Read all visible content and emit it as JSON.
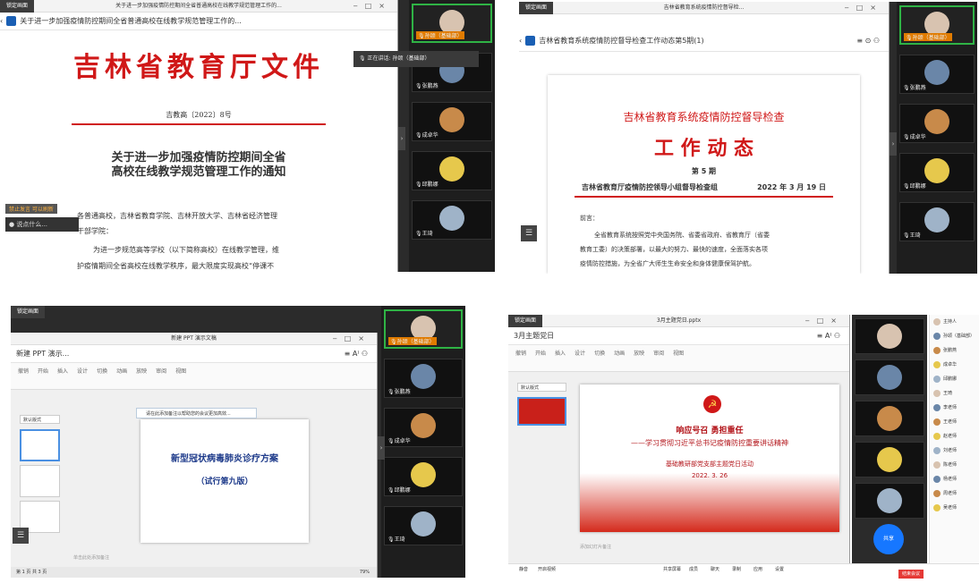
{
  "p1": {
    "lock": "锁定画面",
    "tab": "关于进一步加强疫情防控期间全省普通高校在线教学规范管理工作的...",
    "tab_close": "未保存 ●",
    "title": "吉林省教育厅文件",
    "docnum": "吉教高〔2022〕8号",
    "heading1": "关于进一步加强疫情防控期间全省",
    "heading2": "高校在线教学规范管理工作的通知",
    "body1": "各普通高校，吉林省教育学院、吉林开放大学、吉林省经济管理",
    "body2": "干部学院：",
    "body3": "为进一步规范高等学校（以下简称高校）在线教学管理，维",
    "body4": "护疫情期间全省高校在线教学秩序，最大限度实现高校“停课不",
    "speaking": "正在讲话: 孙颂（基础部）",
    "mic_badge": "孙颂(基础部)",
    "chat_hint": "说点什么...",
    "chat_label": "禁止发言 可以刷新",
    "participants": [
      "孙颂（基础部）",
      "张鹏燕",
      "成卓华",
      "邱鹏娜",
      "王琦"
    ]
  },
  "p2": {
    "lock": "锁定画面",
    "title": "吉林省教育系统疫情防控督导检查工作动态第5期(1)",
    "winttl": "吉林省教育系统疫情防控督导检...",
    "heading": "吉林省教育系统疫情防控督导检查",
    "big": "工 作 动 态",
    "issue": "第 5 期",
    "org": "吉林省教育厅疫情防控领导小组督导检查组",
    "date": "2022 年 3 月 19 日",
    "salute": "前言：",
    "p1": "全省教育系统按照党中央国务院、省委省政府、省教育厅（省委",
    "p2": "教育工委）的决策部署，以最大的努力、最快的速度，全面落实各项",
    "p3": "疫情防控措施，为全省广大师生生命安全和身体健康保驾护航。",
    "participants": [
      "孙颂（基础部）",
      "张鹏燕",
      "成卓华",
      "邱鹏娜",
      "王琦"
    ]
  },
  "p3": {
    "lock": "锁定画面",
    "doc_title": "新建 PPT 演示...",
    "winttl": "新建 PPT 演示文稿",
    "notice": "请在此添加备注以帮助您的会议更加高效...",
    "slide1": "新型冠状病毒肺炎诊疗方案",
    "slide2": "（试行第九版）",
    "notes": "单击此处添加备注",
    "page": "第 1 页 共 3 页",
    "zoom": "79%",
    "layout": "默认版式",
    "tools": [
      "撤销",
      "开始",
      "插入",
      "设计",
      "切换",
      "动画",
      "放映",
      "审阅",
      "视图"
    ],
    "participants": [
      "孙颂（基础部）",
      "张鹏燕",
      "成卓华",
      "邱鹏娜",
      "王琦"
    ]
  },
  "p4": {
    "lock": "锁定画面",
    "doc_title": "3月主题党日",
    "winttl": "3月主题党日.pptx",
    "line1": "响应号召  勇担重任",
    "line2": "——学习贯彻习近平总书记疫情防控重要讲话精神",
    "line3": "基础教研部党支部主题党日活动",
    "line4": "2022. 3. 26",
    "notes": "添加幻灯片备注",
    "layout": "默认版式",
    "tools": [
      "撤销",
      "开始",
      "插入",
      "设计",
      "切换",
      "动画",
      "放映",
      "审阅",
      "视图"
    ],
    "end_btn": "结束会议",
    "share_btn": "共享",
    "bottom": [
      "静音",
      "开启视频",
      "共享屏幕",
      "成员",
      "聊天",
      "录制",
      "应用",
      "设置"
    ],
    "members": [
      "主持人",
      "孙颂（基础部）",
      "张鹏燕",
      "成卓华",
      "邱鹏娜",
      "王琦",
      "李老师",
      "王老师",
      "赵老师",
      "刘老师",
      "陈老师",
      "杨老师",
      "周老师",
      "吴老师"
    ]
  }
}
